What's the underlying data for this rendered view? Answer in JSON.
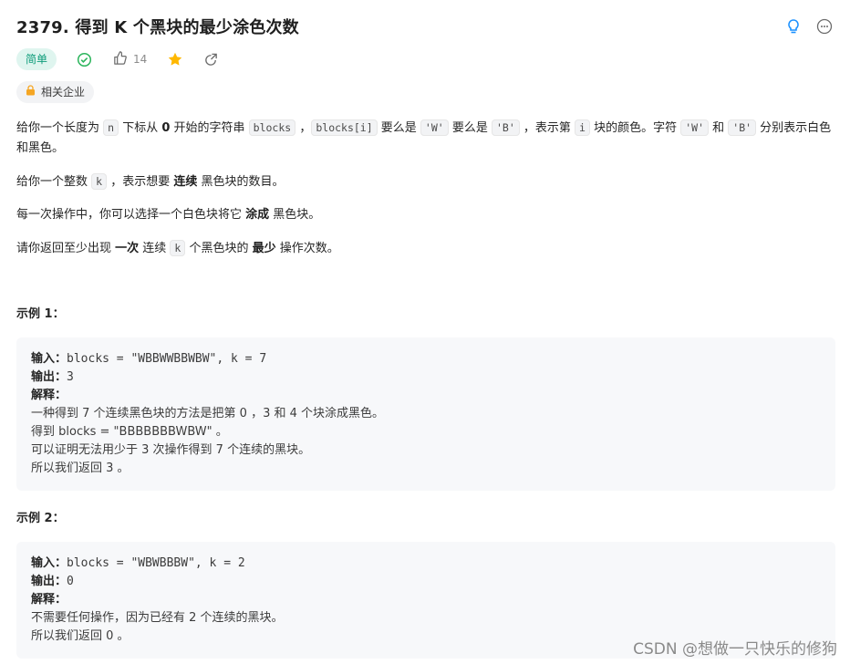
{
  "problem": {
    "title": "2379. 得到 K 个黑块的最少涂色次数",
    "difficulty": "简单",
    "likes": "14",
    "company_tag": "相关企业"
  },
  "description": {
    "p1": {
      "t1": "给你一个长度为 ",
      "c1": "n",
      "t2": " 下标从 ",
      "b1": "0",
      "t3": " 开始的字符串 ",
      "c2": "blocks",
      "t4": " ，",
      "c3": "blocks[i]",
      "t5": " 要么是 ",
      "c4": "'W'",
      "t6": " 要么是 ",
      "c5": "'B'",
      "t7": " ，表示第 ",
      "c6": "i",
      "t8": " 块的颜色。字符 ",
      "c7": "'W'",
      "t9": " 和 ",
      "c8": "'B'",
      "t10": " 分别表示白色和黑色。"
    },
    "p2": {
      "t1": "给你一个整数 ",
      "c1": "k",
      "t2": " ，表示想要 ",
      "b1": "连续",
      "t3": " 黑色块的数目。"
    },
    "p3": {
      "t1": "每一次操作中，你可以选择一个白色块将它 ",
      "b1": "涂成",
      "t2": " 黑色块。"
    },
    "p4": {
      "t1": "请你返回至少出现 ",
      "b1": "一次",
      "t2": " 连续 ",
      "c1": "k",
      "t3": " 个黑色块的 ",
      "b2": "最少",
      "t4": " 操作次数。"
    }
  },
  "examples": [
    {
      "title": "示例 1：",
      "input_label": "输入：",
      "input": "blocks = \"WBBWWBBWBW\", k = 7",
      "output_label": "输出：",
      "output": "3",
      "explain_label": "解释：",
      "lines": [
        "一种得到 7 个连续黑色块的方法是把第 0 ，3 和 4 个块涂成黑色。",
        "得到 blocks = \"BBBBBBBWBW\" 。",
        "可以证明无法用少于 3 次操作得到 7 个连续的黑块。",
        "所以我们返回 3 。"
      ]
    },
    {
      "title": "示例 2：",
      "input_label": "输入：",
      "input": "blocks = \"WBWBBBW\", k = 2",
      "output_label": "输出：",
      "output": "0",
      "explain_label": "解释：",
      "lines": [
        "不需要任何操作，因为已经有 2 个连续的黑块。",
        "所以我们返回 0 。"
      ]
    }
  ],
  "watermark": "CSDN @想做一只快乐的修狗",
  "icons": {
    "hint": "lightbulb-icon",
    "more": "more-icon",
    "solved": "check-circle-icon",
    "like": "thumbs-up-icon",
    "favorite": "star-icon",
    "share": "share-icon",
    "lock": "lock-icon"
  },
  "colors": {
    "accent_blue": "#1a90ff",
    "easy_green": "#0e9c7a",
    "solved_green": "#2db55d",
    "star": "#ffb800"
  }
}
